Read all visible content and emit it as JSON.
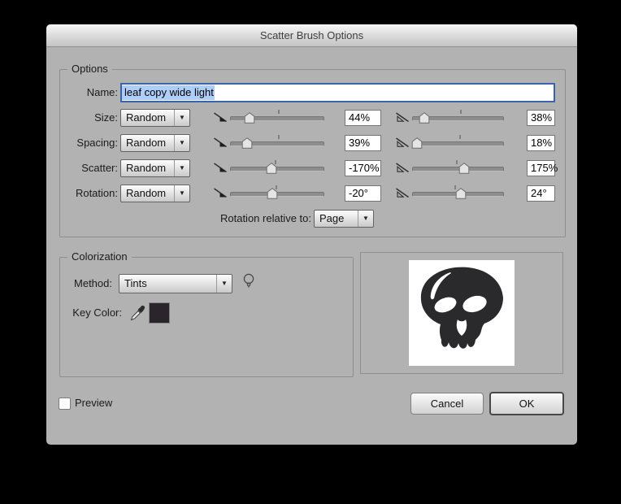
{
  "window": {
    "title": "Scatter Brush Options"
  },
  "icons": {
    "dropdown_arrow": "▼"
  },
  "options": {
    "group_label": "Options",
    "name_label": "Name:",
    "name_value": "leaf copy wide light",
    "rows": [
      {
        "label": "Size:",
        "mode": "Random",
        "min_value": "44%",
        "max_value": "38%",
        "min_thumb_pct": 21,
        "min_tick_pct": 52,
        "max_thumb_pct": 13,
        "max_tick_pct": 53
      },
      {
        "label": "Spacing:",
        "mode": "Random",
        "min_value": "39%",
        "max_value": "18%",
        "min_thumb_pct": 18,
        "min_tick_pct": 52,
        "max_thumb_pct": 5,
        "max_tick_pct": 52
      },
      {
        "label": "Scatter:",
        "mode": "Random",
        "min_value": "-170%",
        "max_value": "175%",
        "min_thumb_pct": 44,
        "min_tick_pct": 48,
        "max_thumb_pct": 57,
        "max_tick_pct": 49
      },
      {
        "label": "Rotation:",
        "mode": "Random",
        "min_value": "-20°",
        "max_value": "24°",
        "min_thumb_pct": 45,
        "min_tick_pct": 49,
        "max_thumb_pct": 53,
        "max_tick_pct": 47
      }
    ],
    "rotation_relative_label": "Rotation relative to:",
    "rotation_relative_value": "Page"
  },
  "colorization": {
    "group_label": "Colorization",
    "method_label": "Method:",
    "method_value": "Tints",
    "key_color_label": "Key Color:"
  },
  "footer": {
    "preview_label": "Preview",
    "preview_checked": false,
    "cancel_label": "Cancel",
    "ok_label": "OK"
  },
  "colors": {
    "dialog_background": "#b2b2b2",
    "focus_border_blue": "#3a64a9",
    "text_selection_blue": "#aecdf8",
    "key_color_swatch": "#29252b",
    "brush_preview_color": "#2a292c"
  }
}
